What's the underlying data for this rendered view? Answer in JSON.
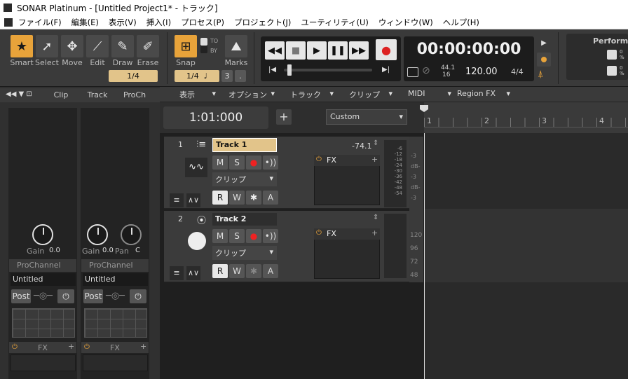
{
  "window": {
    "title": "SONAR Platinum - [Untitled Project1* - トラック]"
  },
  "menu": [
    "ファイル(F)",
    "編集(E)",
    "表示(V)",
    "挿入(I)",
    "プロセス(P)",
    "プロジェクト(J)",
    "ユーティリティ(U)",
    "ウィンドウ(W)",
    "ヘルプ(H)"
  ],
  "tools": {
    "smart": "Smart",
    "select": "Select",
    "move": "Move",
    "edit": "Edit",
    "draw": "Draw",
    "erase": "Erase",
    "resolution": "1/4",
    "snap": "Snap",
    "snap_to": "TO",
    "snap_by": "BY",
    "marks": "Marks",
    "snap_value": "1/4",
    "snap_note": "♩",
    "snap_3": "3",
    "snap_dot": "."
  },
  "transport": {
    "time": "00:00:00:00",
    "sample_rate": "44.1",
    "bit_depth": "16",
    "tempo": "120.00",
    "meter": "4/4"
  },
  "performance": {
    "label": "Performa",
    "pct1": "0 %",
    "pct2": "0 %"
  },
  "left": {
    "tabs": [
      "Clip",
      "Track",
      "ProCh"
    ],
    "strips": [
      {
        "gain_label": "Gain",
        "gain": "0.0",
        "prochannel": "ProChannel",
        "preset": "Untitled",
        "post": "Post",
        "fx": "FX"
      },
      {
        "gain_label": "Gain",
        "gain": "0.0",
        "pan_label": "Pan",
        "pan": "C",
        "prochannel": "ProChannel",
        "preset": "Untitled",
        "post": "Post",
        "fx": "FX"
      }
    ]
  },
  "trackview": {
    "menus": [
      "表示",
      "オプション",
      "トラック",
      "クリップ",
      "MIDI",
      "Region FX"
    ],
    "now_time": "1:01:000",
    "add": "+",
    "preset": "Custom",
    "ruler": [
      "1",
      "2",
      "3",
      "4"
    ]
  },
  "tracks": [
    {
      "num": "1",
      "name": "Track 1",
      "vol": "-74.1",
      "m": "M",
      "s": "S",
      "input": "クリップ",
      "r": "R",
      "w": "W",
      "star": "✱",
      "a": "A",
      "fx": "FX",
      "meter": [
        "-6",
        "-12",
        "-18",
        "-24",
        "-30",
        "-36",
        "-42",
        "-48",
        "-54"
      ]
    },
    {
      "num": "2",
      "name": "Track 2",
      "m": "M",
      "s": "S",
      "input": "クリップ",
      "r": "R",
      "w": "W",
      "star": "✱",
      "a": "A",
      "fx": "FX"
    }
  ],
  "right_meter_1": [
    "-3",
    "dB-",
    "-3",
    "dB-",
    "-3"
  ],
  "right_meter_2": [
    "120",
    "96",
    "72",
    "48"
  ]
}
